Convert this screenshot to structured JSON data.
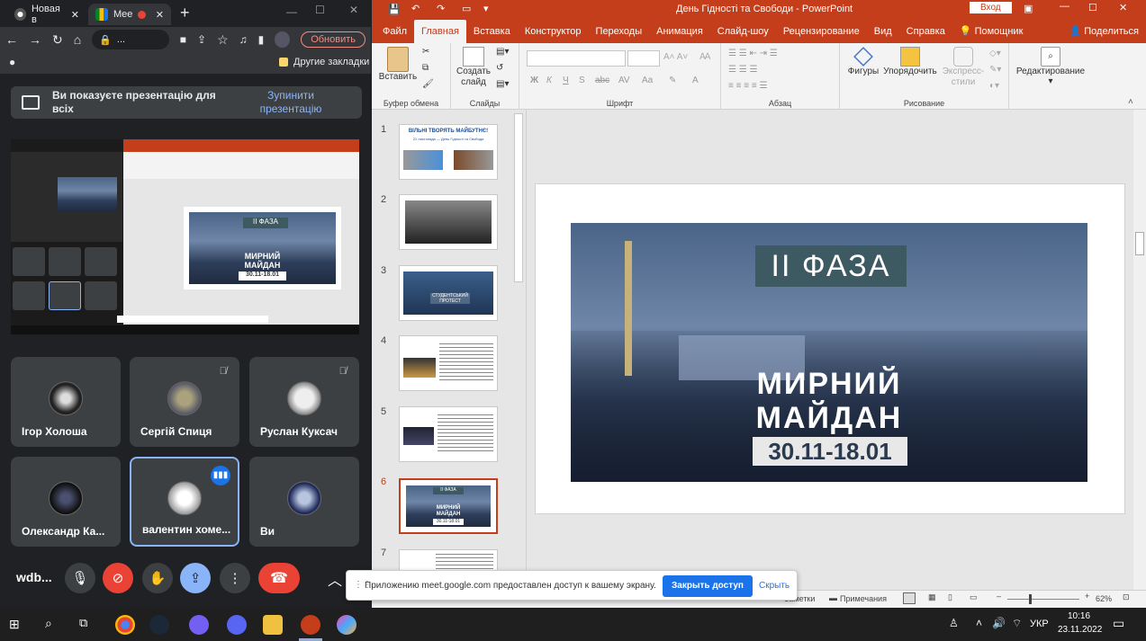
{
  "chrome": {
    "tabs": [
      {
        "label": "Новая в"
      },
      {
        "label": "Mee"
      }
    ],
    "new_tab_symbol": "+",
    "update_button": "Обновить",
    "other_bookmarks": "Другие закладки"
  },
  "meet": {
    "presenting_text": "Ви показуєте презентацію для всіх",
    "stop_button": "Зупинити презентацію",
    "participants": [
      {
        "name": "Ігор Холоша"
      },
      {
        "name": "Сергій Спиця"
      },
      {
        "name": "Руслан Куксач"
      },
      {
        "name": "Олександр Ка..."
      },
      {
        "name": "валентин хоме..."
      },
      {
        "name": "Ви"
      }
    ],
    "meeting_code": "wdb..."
  },
  "ppt": {
    "title": "День Гідності та Свободи  -  PowerPoint",
    "signin_button": "Вход",
    "tabs": [
      "Файл",
      "Главная",
      "Вставка",
      "Конструктор",
      "Переходы",
      "Анимация",
      "Слайд-шоу",
      "Рецензирование",
      "Вид",
      "Справка",
      "Помощник"
    ],
    "share": "Поделиться",
    "groups": {
      "clipboard": "Буфер обмена",
      "paste": "Вставить",
      "slides": "Слайды",
      "new_slide": "Создать слайд",
      "font": "Шрифт",
      "paragraph": "Абзац",
      "drawing": "Рисование",
      "shapes": "Фигуры",
      "arrange": "Упорядочить",
      "quick_styles": "Экспресс-стили",
      "editing": "Редактирование"
    },
    "slide_numbers": [
      "1",
      "2",
      "3",
      "4",
      "5",
      "6",
      "7"
    ],
    "slide1_title": "ВІЛЬНІ ТВОРЯТЬ МАЙБУТНЄ!",
    "slide1_subtitle": "21 листопада — День Гідності та Свободи",
    "slide3_text": "СТУДЕНТСЬКИЙ ПРОТЕСТ",
    "slide_phase": "II ФАЗА",
    "slide_line1": "МИРНИЙ",
    "slide_line2": "МАЙДАН",
    "slide_dates": "30.11-18.01",
    "status": {
      "notes": "Заметки",
      "comments": "Примечания",
      "zoom": "62%"
    }
  },
  "toast": {
    "message": "Приложению meet.google.com предоставлен доступ к вашему экрану.",
    "close_access": "Закрыть доступ",
    "hide": "Скрыть"
  },
  "taskbar": {
    "lang": "УКР",
    "time": "10:16",
    "date": "23.11.2022"
  },
  "colors": {
    "ppt_accent": "#c43e1c",
    "meet_blue": "#8ab4f8",
    "end_call_red": "#ea4335"
  }
}
